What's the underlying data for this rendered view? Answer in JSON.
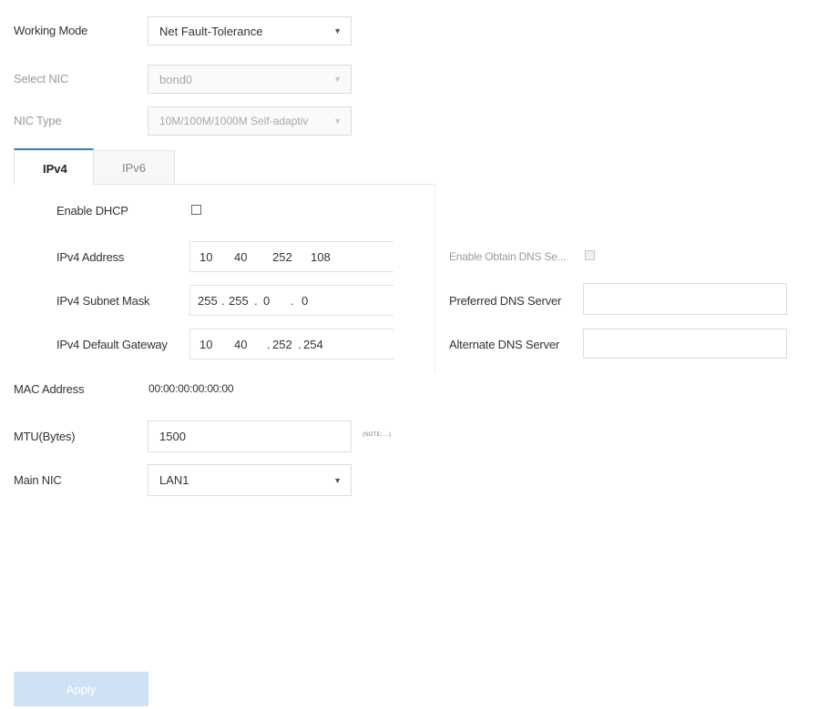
{
  "top": {
    "working_mode": {
      "label": "Working Mode",
      "value": "Net Fault-Tolerance"
    },
    "select_nic": {
      "label": "Select NIC",
      "value": "bond0"
    },
    "nic_type": {
      "label": "NIC Type",
      "value": "10M/100M/1000M Self-adaptiv"
    }
  },
  "tabs": [
    {
      "label": "IPv4",
      "active": true
    },
    {
      "label": "IPv6",
      "active": false
    }
  ],
  "ipv4": {
    "enable_dhcp_label": "Enable DHCP",
    "enable_dhcp_checked": false,
    "address": {
      "label": "IPv4 Address",
      "octets": [
        "10",
        "40",
        "252",
        "108"
      ]
    },
    "subnet_mask": {
      "label": "IPv4 Subnet Mask",
      "octets": [
        "255",
        "255",
        "0",
        "0"
      ]
    },
    "default_gateway": {
      "label": "IPv4 Default Gateway",
      "octets": [
        "10",
        "40",
        "252",
        "254"
      ]
    }
  },
  "dns": {
    "enable_obtain_label": "Enable Obtain DNS Se...",
    "enable_obtain_checked": false,
    "preferred_label": "Preferred DNS Server",
    "preferred_value": "",
    "alternate_label": "Alternate DNS Server",
    "alternate_value": ""
  },
  "mac": {
    "label": "MAC Address",
    "value": "00:00:00:00:00:00"
  },
  "mtu": {
    "label": "MTU(Bytes)",
    "value": "1500",
    "note": "(NOTE: ...)"
  },
  "main_nic": {
    "label": "Main NIC",
    "value": "LAN1"
  },
  "apply_label": "Apply",
  "colors": {
    "apply_bg": "#cfe1f5",
    "apply_text": "#ffffff"
  }
}
